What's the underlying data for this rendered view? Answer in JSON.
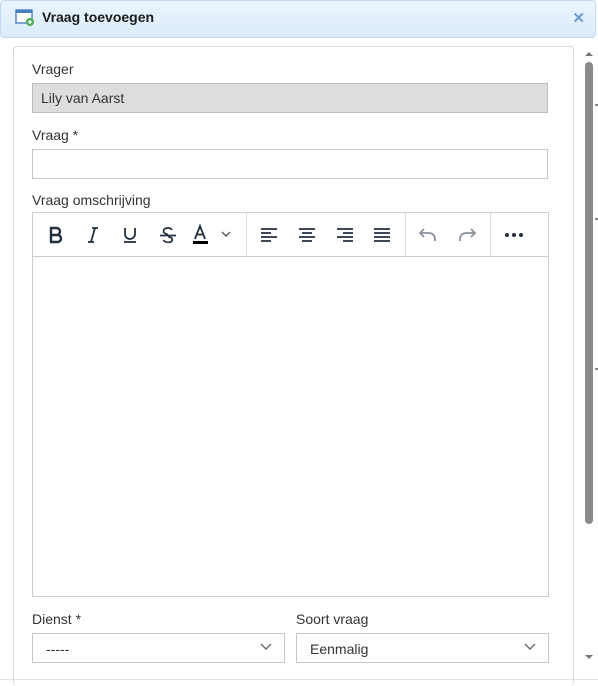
{
  "window": {
    "title": "Vraag toevoegen",
    "icon": "window-add-icon",
    "close_icon": "close-icon"
  },
  "form": {
    "requester": {
      "label": "Vrager",
      "value": "Lily van Aarst"
    },
    "question": {
      "label": "Vraag",
      "required_mark": "*",
      "value": ""
    },
    "description": {
      "label": "Vraag omschrijving"
    },
    "service": {
      "label": "Dienst",
      "required_mark": "*",
      "value": "-----"
    },
    "question_type": {
      "label": "Soort vraag",
      "value": "Eenmalig"
    }
  },
  "toolbar": {
    "buttons": [
      "bold-icon",
      "italic-icon",
      "underline-icon",
      "strikethrough-icon",
      "text-color-icon",
      "align-left-icon",
      "align-center-icon",
      "align-right-icon",
      "align-justify-icon",
      "undo-icon",
      "redo-icon",
      "more-icon"
    ]
  },
  "colors": {
    "titlebar_bg": "#dcecfb",
    "close_icon": "#6b9bd2",
    "readonly_bg": "#dddddd",
    "scrollbar_thumb": "#8a8a8a"
  }
}
